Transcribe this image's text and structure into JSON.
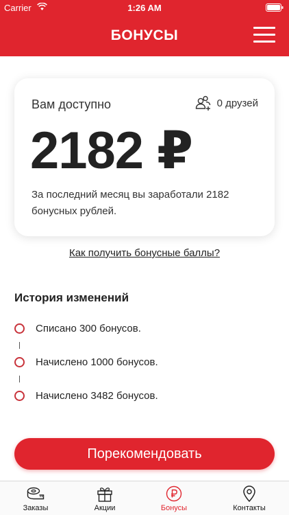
{
  "status_bar": {
    "carrier": "Carrier",
    "time": "1:26 AM"
  },
  "header": {
    "title": "БОНУСЫ"
  },
  "card": {
    "label": "Вам доступно",
    "friends_count": "0 друзей",
    "balance": "2182 ₽",
    "description": "За последний месяц вы заработали 2182 бонусных рублей."
  },
  "how_link": "Как получить бонусные баллы?",
  "history": {
    "title": "История изменений",
    "items": [
      "Списано 300 бонусов.",
      "Начислено 1000 бонусов.",
      "Начислено 3482 бонусов."
    ]
  },
  "recommend_button": "Порекомендовать",
  "tabs": [
    {
      "label": "Заказы",
      "icon": "measuring-tape-icon"
    },
    {
      "label": "Акции",
      "icon": "gift-icon"
    },
    {
      "label": "Бонусы",
      "icon": "ruble-icon"
    },
    {
      "label": "Контакты",
      "icon": "map-pin-icon"
    }
  ],
  "colors": {
    "accent": "#e0252e",
    "history_dot": "#c8323a"
  }
}
